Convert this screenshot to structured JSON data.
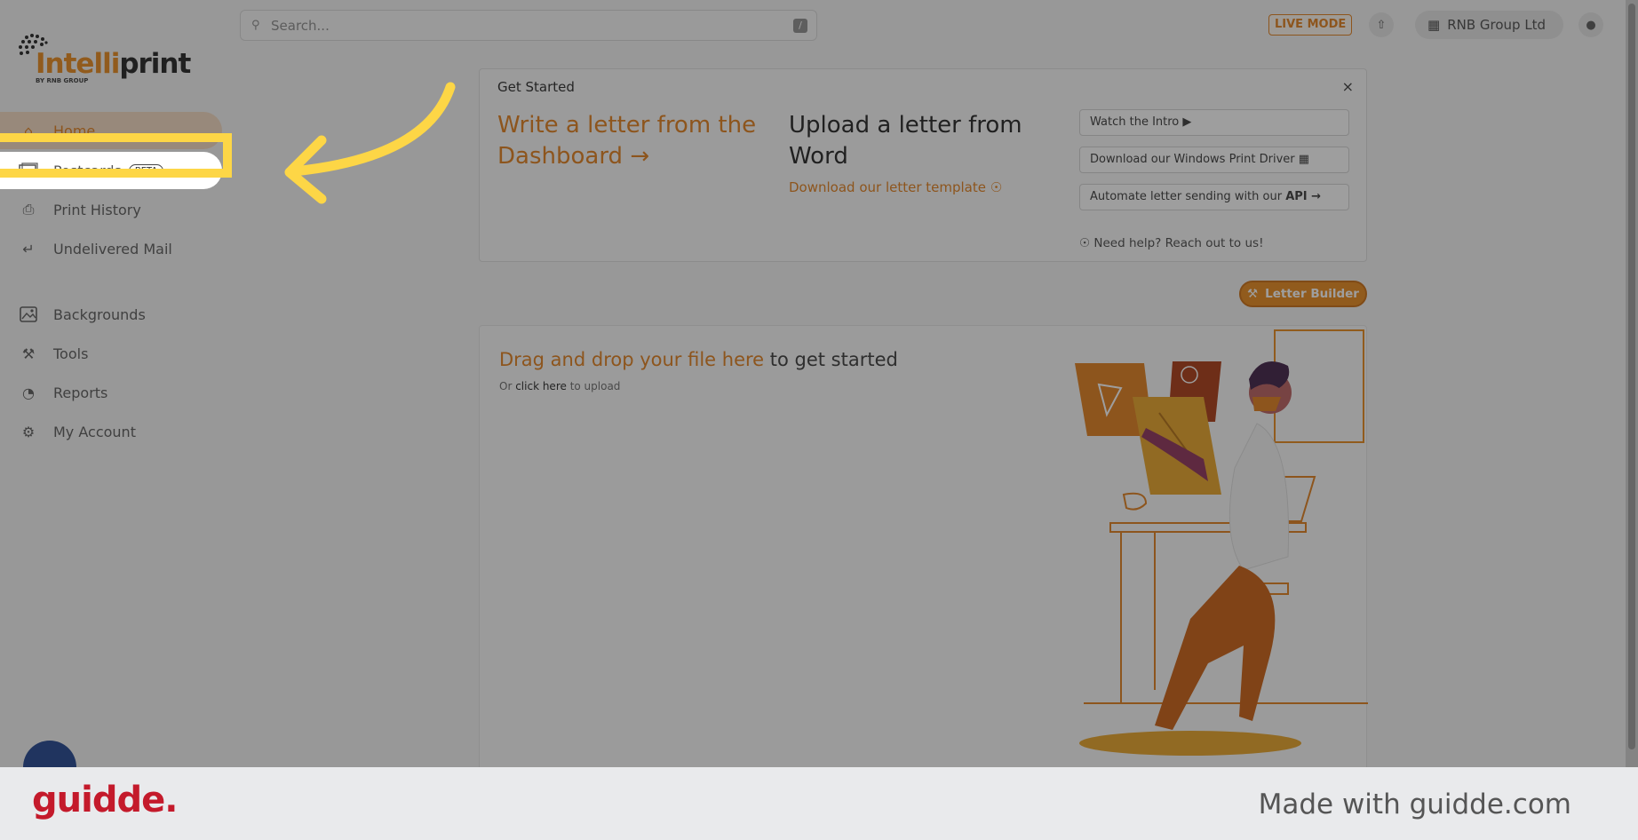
{
  "search": {
    "placeholder": "Search...",
    "shortcut": "/"
  },
  "header": {
    "live_mode": "LIVE MODE",
    "org_name": "RNB Group Ltd"
  },
  "logo": {
    "part_a": "Intelli",
    "part_b": "print",
    "byline": "BY RNB GROUP"
  },
  "sidebar": {
    "items": [
      {
        "label": "Home",
        "icon": "home-icon"
      },
      {
        "label": "Postcards",
        "icon": "postcard-icon",
        "badge": "BETA"
      },
      {
        "label": "Print History",
        "icon": "printer-icon"
      },
      {
        "label": "Undelivered Mail",
        "icon": "return-arrow-icon"
      },
      {
        "label": "Backgrounds",
        "icon": "image-icon"
      },
      {
        "label": "Tools",
        "icon": "hammer-icon"
      },
      {
        "label": "Reports",
        "icon": "pie-chart-icon"
      },
      {
        "label": "My Account",
        "icon": "gear-icon"
      }
    ]
  },
  "get_started": {
    "title": "Get Started",
    "close": "×",
    "write_link": "Write a letter from the Dashboard →",
    "upload_title": "Upload a letter from Word",
    "template_link": "Download our letter template",
    "buttons": [
      {
        "label": "Watch the Intro"
      },
      {
        "label": "Download our Windows Print Driver"
      },
      {
        "label": "Automate letter sending with our",
        "strong": "API →"
      }
    ],
    "help": "Need help? Reach out to us!"
  },
  "letter_builder": "Letter Builder",
  "dropzone": {
    "title_highlight": "Drag and drop your file here",
    "title_rest": " to get started",
    "sub_prefix": "Or ",
    "sub_click": "click here",
    "sub_suffix": " to upload"
  },
  "footer": {
    "brand": "guidde.",
    "made_with": "Made with guidde.com"
  },
  "colors": {
    "accent": "#e07a14",
    "highlight": "#fdd646",
    "brand_red": "#c41a2b"
  }
}
